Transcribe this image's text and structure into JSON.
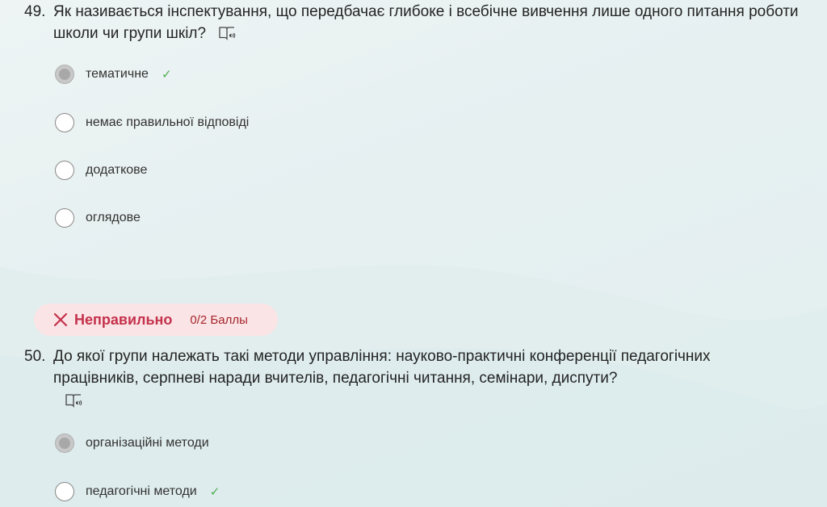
{
  "colors": {
    "background": "#e6f0f1",
    "incorrect": "#c4314b",
    "badge_background": "#fbe4e6",
    "correct_check": "#4caf50"
  },
  "question49": {
    "number": "49.",
    "text": "Як називається інспектування, що передбачає глибоке і всебічне вивчення лише одного питання роботи школи чи групи шкіл?",
    "icon": "immersive-reader-icon",
    "options": [
      {
        "label": "тематичне",
        "selected": true,
        "correct": true
      },
      {
        "label": "немає правильної відповіді",
        "selected": false,
        "correct": false
      },
      {
        "label": "додаткове",
        "selected": false,
        "correct": false
      },
      {
        "label": "оглядове",
        "selected": false,
        "correct": false
      }
    ]
  },
  "result": {
    "icon": "close-icon",
    "label": "Неправильно",
    "score": "0/2 Баллы"
  },
  "question50": {
    "number": "50.",
    "text": "До якої групи належать такі методи управління: науково-практичні конференції педагогічних працівників, серпневі наради вчителів, педагогічні читання, семінари, диспути?",
    "icon": "immersive-reader-icon",
    "options": [
      {
        "label": "організаційні методи",
        "selected": true,
        "correct": false
      },
      {
        "label": "педагогічні методи",
        "selected": false,
        "correct": true
      }
    ]
  }
}
